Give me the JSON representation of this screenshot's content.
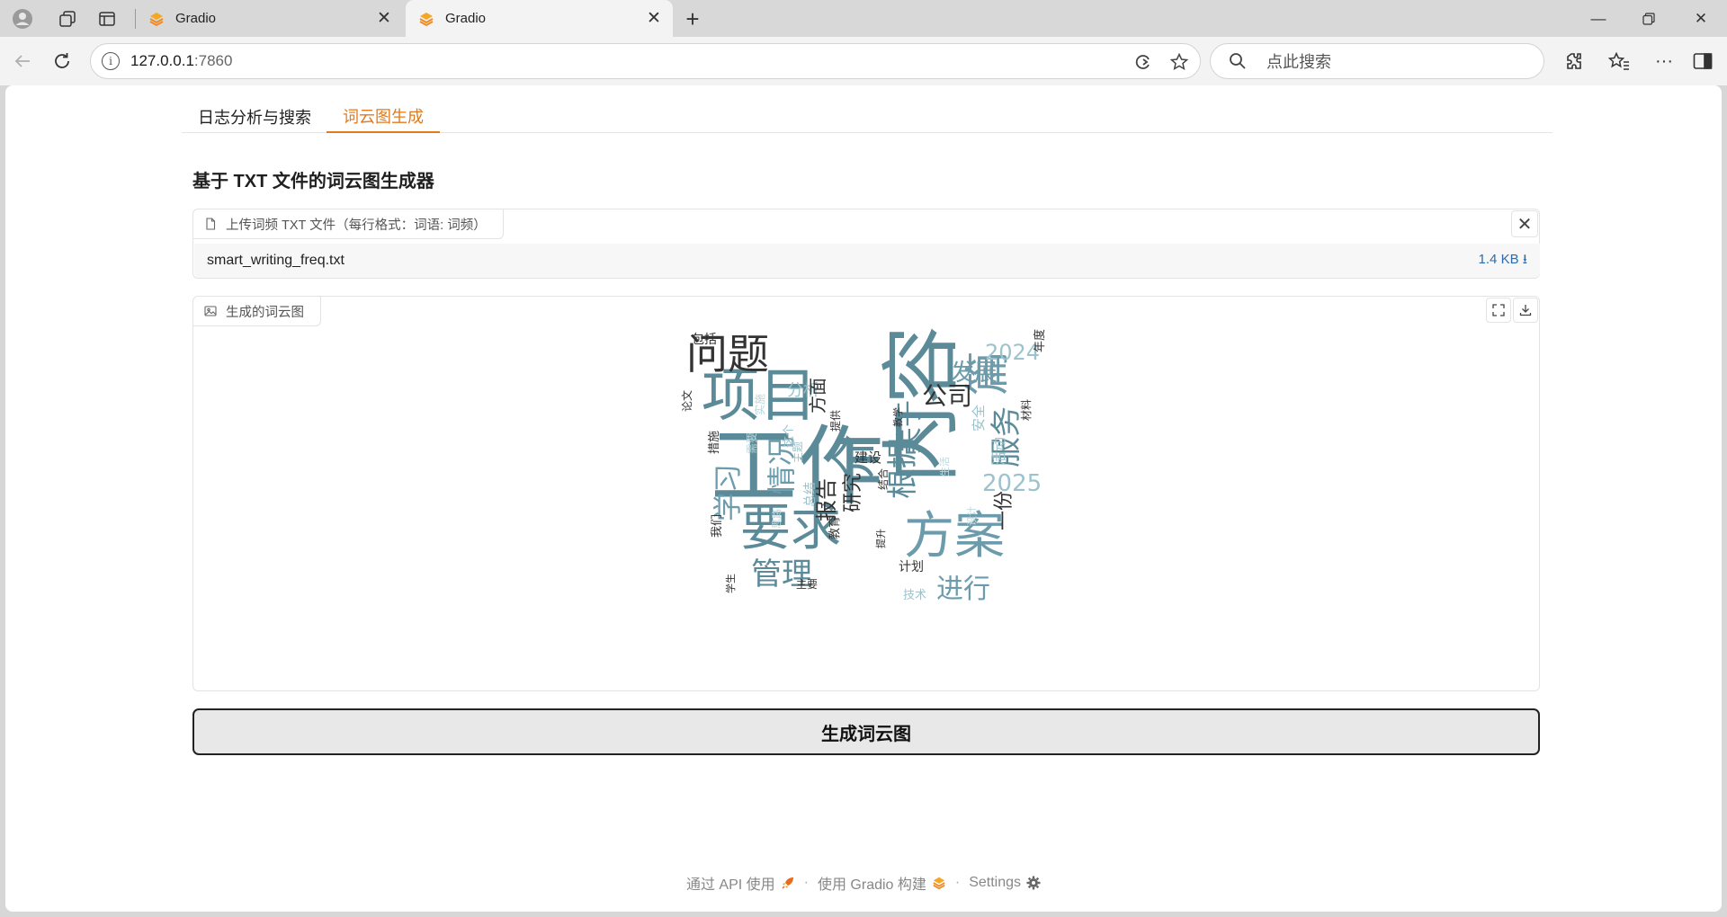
{
  "browser": {
    "tabs": [
      {
        "title": "Gradio",
        "active": false
      },
      {
        "title": "Gradio",
        "active": true
      }
    ],
    "url_host": "127.0.0.1",
    "url_port": ":7860",
    "search_placeholder": "点此搜索"
  },
  "page": {
    "tabs": [
      {
        "label": "日志分析与搜索",
        "selected": false
      },
      {
        "label": "词云图生成",
        "selected": true
      }
    ],
    "heading": "基于 TXT 文件的词云图生成器",
    "upload": {
      "label": "上传词频 TXT 文件（每行格式：词语: 词频）",
      "file_name": "smart_writing_freq.txt",
      "file_size": "1.4 KB ⭳"
    },
    "image": {
      "label": "生成的词云图"
    },
    "generate_button": "生成词云图",
    "footer": {
      "api": "通过 API 使用",
      "built": "使用 Gradio 构建",
      "settings": "Settings"
    }
  },
  "wordcloud": {
    "words": [
      "工作",
      "内容",
      "项目",
      "要求",
      "方案",
      "问题",
      "篇",
      "服务",
      "根据",
      "介",
      "情况",
      "管理",
      "学习",
      "关于",
      "公司",
      "发展",
      "2024",
      "2025",
      "进行",
      "一份",
      "报告",
      "研究",
      "分析",
      "方面",
      "建设",
      "包括",
      "活动",
      "安全",
      "年度",
      "材料",
      "教学",
      "论文",
      "措施",
      "需要",
      "实施",
      "这个",
      "提供",
      "主题",
      "总结",
      "结合",
      "生活",
      "提升",
      "计划",
      "技术",
      "教育",
      "主要",
      "学生",
      "我们",
      "思路",
      "设计"
    ],
    "colors": {
      "dark": "#5b8a99",
      "mid": "#6c9cab",
      "light": "#9cc3cc",
      "pale": "#b9d7dc",
      "ink": "#333333"
    }
  },
  "colors": {
    "accent": "#e07b1f",
    "link": "#2b6cb0"
  }
}
